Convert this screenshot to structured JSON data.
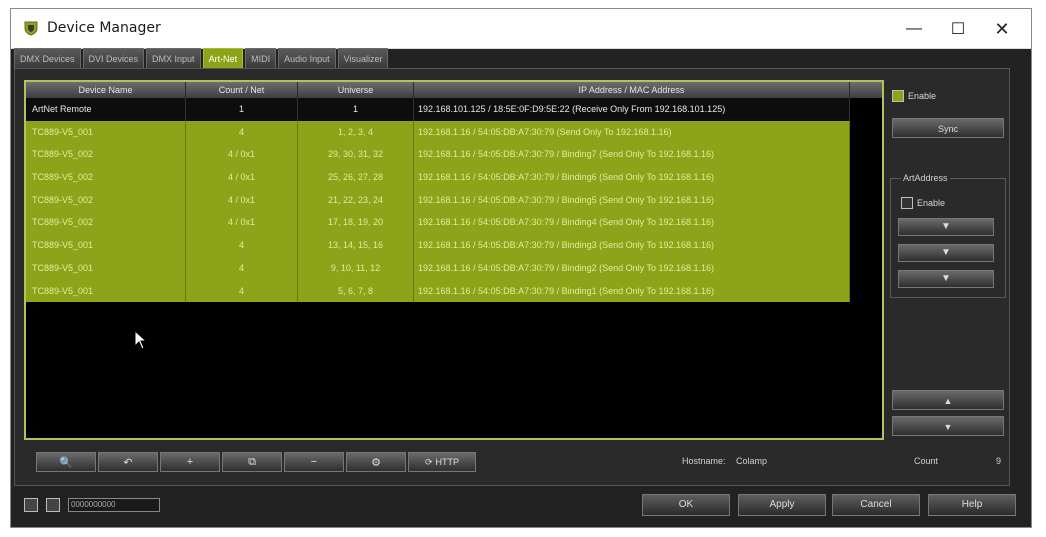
{
  "window": {
    "title": "Device Manager",
    "controls": {
      "minimize": "—",
      "maximize": "☐",
      "close": "✕"
    }
  },
  "tabs": [
    {
      "label": "DMX Devices",
      "active": false
    },
    {
      "label": "DVI Devices",
      "active": false
    },
    {
      "label": "DMX Input",
      "active": false
    },
    {
      "label": "Art-Net",
      "active": true
    },
    {
      "label": "MIDI",
      "active": false
    },
    {
      "label": "Audio Input",
      "active": false
    },
    {
      "label": "Visualizer",
      "active": false
    }
  ],
  "table": {
    "columns": [
      "Device Name",
      "Count / Net",
      "Universe",
      "IP Address / MAC Address"
    ],
    "rows": [
      {
        "name": "ArtNet Remote",
        "count": "1",
        "universe": "1",
        "ip": "192.168.101.125 / 18:5E:0F:D9:5E:22 (Receive Only From 192.168.101.125)",
        "selected": false
      },
      {
        "name": "TC889-V5_001",
        "count": "4",
        "universe": "1, 2, 3, 4",
        "ip": "192.168.1.16 / 54:05:DB:A7:30:79 (Send Only To 192.168.1.16)",
        "selected": true
      },
      {
        "name": "TC889-V5_002",
        "count": "4 / 0x1",
        "universe": "29, 30, 31, 32",
        "ip": "192.168.1.16 / 54:05:DB:A7:30:79 / Binding7 (Send Only To 192.168.1.16)",
        "selected": true
      },
      {
        "name": "TC889-V5_002",
        "count": "4 / 0x1",
        "universe": "25, 26, 27, 28",
        "ip": "192.168.1.16 / 54:05:DB:A7:30:79 / Binding6 (Send Only To 192.168.1.16)",
        "selected": true
      },
      {
        "name": "TC889-V5_002",
        "count": "4 / 0x1",
        "universe": "21, 22, 23, 24",
        "ip": "192.168.1.16 / 54:05:DB:A7:30:79 / Binding5 (Send Only To 192.168.1.16)",
        "selected": true
      },
      {
        "name": "TC889-V5_002",
        "count": "4 / 0x1",
        "universe": "17, 18, 19, 20",
        "ip": "192.168.1.16 / 54:05:DB:A7:30:79 / Binding4 (Send Only To 192.168.1.16)",
        "selected": true
      },
      {
        "name": "TC889-V5_001",
        "count": "4",
        "universe": "13, 14, 15, 16",
        "ip": "192.168.1.16 / 54:05:DB:A7:30:79 / Binding3 (Send Only To 192.168.1.16)",
        "selected": true
      },
      {
        "name": "TC889-V5_001",
        "count": "4",
        "universe": "9, 10, 11, 12",
        "ip": "192.168.1.16 / 54:05:DB:A7:30:79 / Binding2 (Send Only To 192.168.1.16)",
        "selected": true
      },
      {
        "name": "TC889-V5_001",
        "count": "4",
        "universe": "5, 6, 7, 8",
        "ip": "192.168.1.16 / 54:05:DB:A7:30:79 / Binding1 (Send Only To 192.168.1.16)",
        "selected": true
      }
    ]
  },
  "right_panel": {
    "enable_label": "Enable",
    "sync_label": "Sync",
    "artaddress_label": "ArtAddress",
    "artaddress_enable_label": "Enable",
    "spin_glyph": "▼",
    "up_glyph": "▲",
    "down_glyph": "▼"
  },
  "toolbar": {
    "buttons": [
      {
        "icon": "search-icon",
        "glyph": "🔍"
      },
      {
        "icon": "undo-icon",
        "glyph": "↶"
      },
      {
        "icon": "add-icon",
        "glyph": "+"
      },
      {
        "icon": "copy-icon",
        "glyph": "⧉"
      },
      {
        "icon": "remove-icon",
        "glyph": "−"
      },
      {
        "icon": "settings-icon",
        "glyph": "⚙"
      },
      {
        "icon": "refresh-icon",
        "glyph": "⟳",
        "label": "HTTP"
      }
    ]
  },
  "status": {
    "hostname_label": "Hostname:",
    "hostname_value": "Colamp",
    "count_label": "Count",
    "count_value": "9",
    "field_text": "0000000000"
  },
  "footer": {
    "ok": "OK",
    "apply": "Apply",
    "cancel": "Cancel",
    "help": "Help"
  },
  "colors": {
    "accent": "#8ca31a",
    "background": "#222222"
  }
}
